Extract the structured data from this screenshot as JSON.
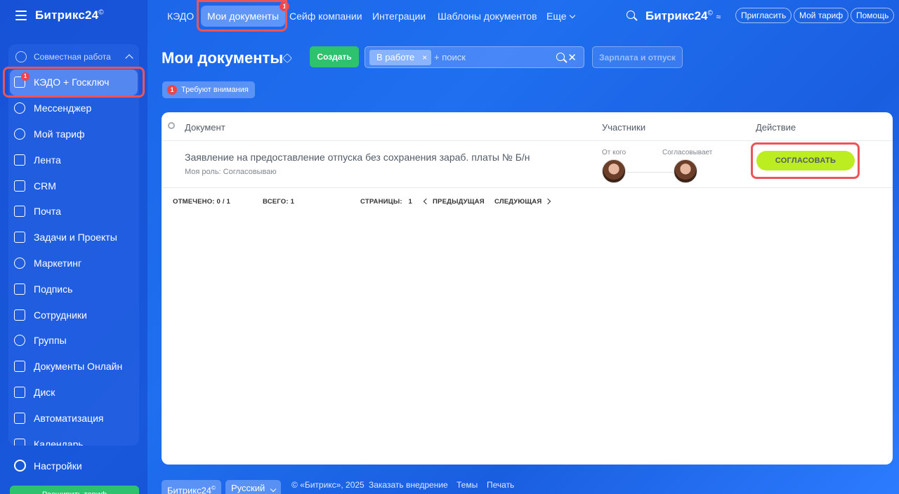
{
  "sidebar": {
    "brand": "Битрикс24",
    "brand_mark": "©",
    "group_label": "Совместная работа",
    "items": [
      {
        "label": "КЭДО + Госключ",
        "icon": "kedo-icon",
        "badge": "1"
      },
      {
        "label": "Мессенджер",
        "icon": "messenger-icon"
      },
      {
        "label": "Мой тариф",
        "icon": "tariff-icon"
      },
      {
        "label": "Лента",
        "icon": "feed-icon"
      },
      {
        "label": "CRM",
        "icon": "crm-icon"
      },
      {
        "label": "Почта",
        "icon": "mail-icon"
      },
      {
        "label": "Задачи и Проекты",
        "icon": "tasks-icon"
      },
      {
        "label": "Маркетинг",
        "icon": "marketing-icon"
      },
      {
        "label": "Подпись",
        "icon": "signature-icon"
      },
      {
        "label": "Сотрудники",
        "icon": "employees-icon"
      },
      {
        "label": "Группы",
        "icon": "groups-icon"
      },
      {
        "label": "Документы Онлайн",
        "icon": "docs-online-icon"
      },
      {
        "label": "Диск",
        "icon": "disk-icon"
      },
      {
        "label": "Автоматизация",
        "icon": "automation-icon"
      },
      {
        "label": "Календарь",
        "icon": "calendar-icon"
      }
    ],
    "settings_label": "Настройки",
    "upgrade_label": "Расширить тариф"
  },
  "topnav": {
    "tabs": [
      {
        "label": "КЭДО"
      },
      {
        "label": "Мои документы",
        "badge": "1"
      },
      {
        "label": "Сейф компании"
      },
      {
        "label": "Интеграции"
      },
      {
        "label": "Шаблоны документов"
      },
      {
        "label": "Еще"
      }
    ],
    "brand": "Битрикс24",
    "brand_mark": "©",
    "invite": "Пригласить",
    "my_tariff": "Мой тариф",
    "help": "Помощь"
  },
  "toolbar": {
    "title": "Мои документы",
    "create": "Создать",
    "filter_tag": "В работе",
    "filter_tag_close": "×",
    "search_placeholder": "+ поиск",
    "clear": "✕",
    "salary": "Зарплата и отпуск",
    "attention_count": "1",
    "attention_label": "Требуют внимания"
  },
  "table": {
    "headers": {
      "document": "Документ",
      "participants": "Участники",
      "action": "Действие"
    },
    "rows": [
      {
        "title": "Заявление на предоставление отпуска без сохранения зараб. платы № Б/н",
        "role": "Моя роль: Согласовываю",
        "from_label": "От кого",
        "approver_label": "Согласовывает",
        "action": "СОГЛАСОВАТЬ"
      }
    ],
    "footer": {
      "checked_label": "ОТМЕЧЕНО:",
      "checked_value": "0 / 1",
      "total_label": "ВСЕГО:",
      "total_value": "1",
      "pages_label": "СТРАНИЦЫ:",
      "pages_value": "1",
      "prev": "ПРЕДЫДУЩАЯ",
      "next": "СЛЕДУЮЩАЯ"
    }
  },
  "bottom": {
    "brand": "Битрикс24",
    "brand_mark": "©",
    "language": "Русский",
    "copyright": "© «Битрикс», 2025",
    "order": "Заказать внедрение",
    "themes": "Темы",
    "print": "Печать"
  },
  "colors": {
    "accent_green": "#2fc26e",
    "approve_lime": "#bbed21",
    "badge_red": "#f0444a",
    "highlight": "#e8565a"
  }
}
